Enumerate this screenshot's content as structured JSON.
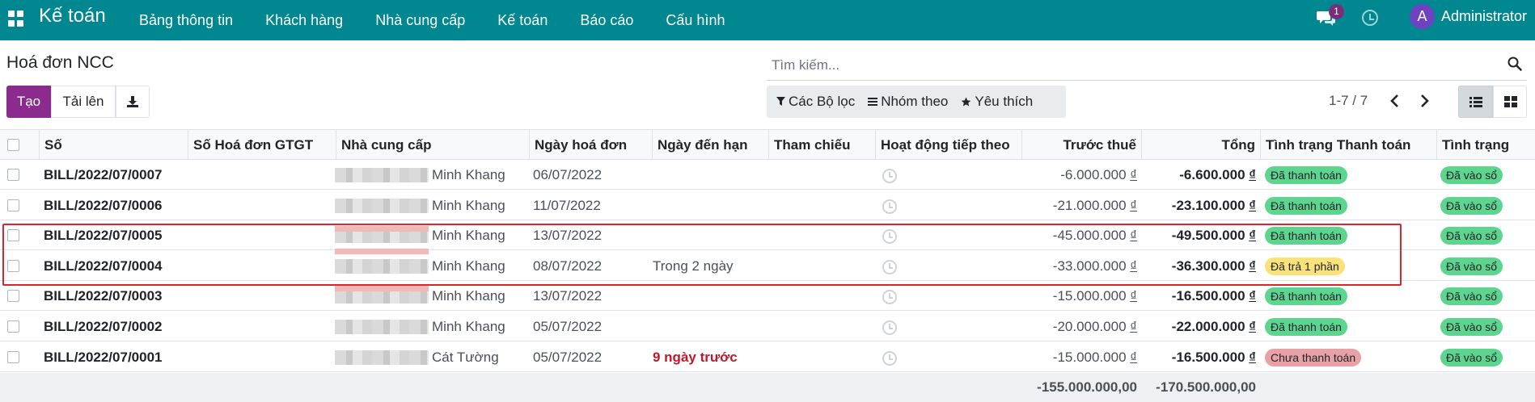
{
  "navbar": {
    "brand": "Kế toán",
    "menu": [
      "Bảng thông tin",
      "Khách hàng",
      "Nhà cung cấp",
      "Kế toán",
      "Báo cáo",
      "Cấu hình"
    ],
    "chat_count": "1",
    "avatar_letter": "A",
    "username": "Administrator",
    "color": "#00878f"
  },
  "control_panel": {
    "title": "Hoá đơn NCC",
    "search_placeholder": "Tìm kiếm...",
    "create_label": "Tạo",
    "upload_label": "Tải lên",
    "filters_label": "Các Bộ lọc",
    "group_by_label": "Nhóm theo",
    "favorites_label": "Yêu thích",
    "pager_value": "1-7 / 7"
  },
  "table": {
    "headers": {
      "number": "Số",
      "vat_invoice": "Số Hoá đơn GTGT",
      "vendor": "Nhà cung cấp",
      "invoice_date": "Ngày hoá đơn",
      "due_date": "Ngày đến hạn",
      "reference": "Tham chiếu",
      "next_activity": "Hoạt động tiếp theo",
      "untaxed": "Trước thuế",
      "total": "Tổng",
      "payment_status": "Tình trạng Thanh toán",
      "status": "Tình trạng"
    },
    "rows": [
      {
        "number": "BILL/2022/07/0007",
        "vendor": "Minh Khang",
        "invoice_date": "06/07/2022",
        "due_date": "",
        "untaxed": "-6.000.000",
        "total": "-6.600.000",
        "payment_status": "Đã thanh toán",
        "payment_kind": "success",
        "status": "Đã vào sổ"
      },
      {
        "number": "BILL/2022/07/0006",
        "vendor": "Minh Khang",
        "invoice_date": "11/07/2022",
        "due_date": "",
        "untaxed": "-21.000.000",
        "total": "-23.100.000",
        "payment_status": "Đã thanh toán",
        "payment_kind": "success",
        "status": "Đã vào sổ"
      },
      {
        "number": "BILL/2022/07/0005",
        "vendor": "Minh Khang",
        "invoice_date": "13/07/2022",
        "due_date": "",
        "untaxed": "-45.000.000",
        "total": "-49.500.000",
        "payment_status": "Đã thanh toán",
        "payment_kind": "success",
        "status": "Đã vào sổ"
      },
      {
        "number": "BILL/2022/07/0004",
        "vendor": "Minh Khang",
        "invoice_date": "08/07/2022",
        "due_date": "Trong 2 ngày",
        "untaxed": "-33.000.000",
        "total": "-36.300.000",
        "payment_status": "Đã trả 1 phần",
        "payment_kind": "warning",
        "status": "Đã vào sổ"
      },
      {
        "number": "BILL/2022/07/0003",
        "vendor": "Minh Khang",
        "invoice_date": "13/07/2022",
        "due_date": "",
        "untaxed": "-15.000.000",
        "total": "-16.500.000",
        "payment_status": "Đã thanh toán",
        "payment_kind": "success",
        "status": "Đã vào sổ"
      },
      {
        "number": "BILL/2022/07/0002",
        "vendor": "Minh Khang",
        "invoice_date": "05/07/2022",
        "due_date": "",
        "untaxed": "-20.000.000",
        "total": "-22.000.000",
        "payment_status": "Đã thanh toán",
        "payment_kind": "success",
        "status": "Đã vào sổ"
      },
      {
        "number": "BILL/2022/07/0001",
        "vendor": "Cát Tường",
        "invoice_date": "05/07/2022",
        "due_date": "9 ngày trước",
        "due_overdue": true,
        "untaxed": "-15.000.000",
        "total": "-16.500.000",
        "payment_status": "Chưa thanh toán",
        "payment_kind": "danger",
        "status": "Đã vào sổ"
      }
    ],
    "currency": "₫",
    "totals": {
      "untaxed": "-155.000.000,00",
      "total": "-170.500.000,00"
    }
  }
}
